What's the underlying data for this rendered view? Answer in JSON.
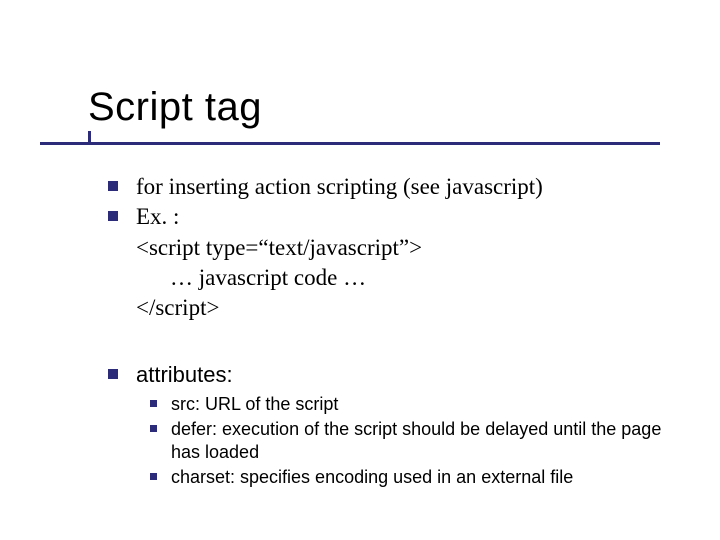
{
  "title": "Script tag",
  "body": {
    "line1": "for inserting action scripting (see javascript)",
    "line2": "Ex. :",
    "line3": "<script type=“text/javascript”>",
    "line4": "… javascript code …",
    "line5": "</script>",
    "attributes_label": "attributes:",
    "attrs": {
      "a1": "src: URL of the script",
      "a2": "defer: execution of the script should be delayed until the page has loaded",
      "a3": "charset: specifies encoding used in an external file"
    }
  }
}
